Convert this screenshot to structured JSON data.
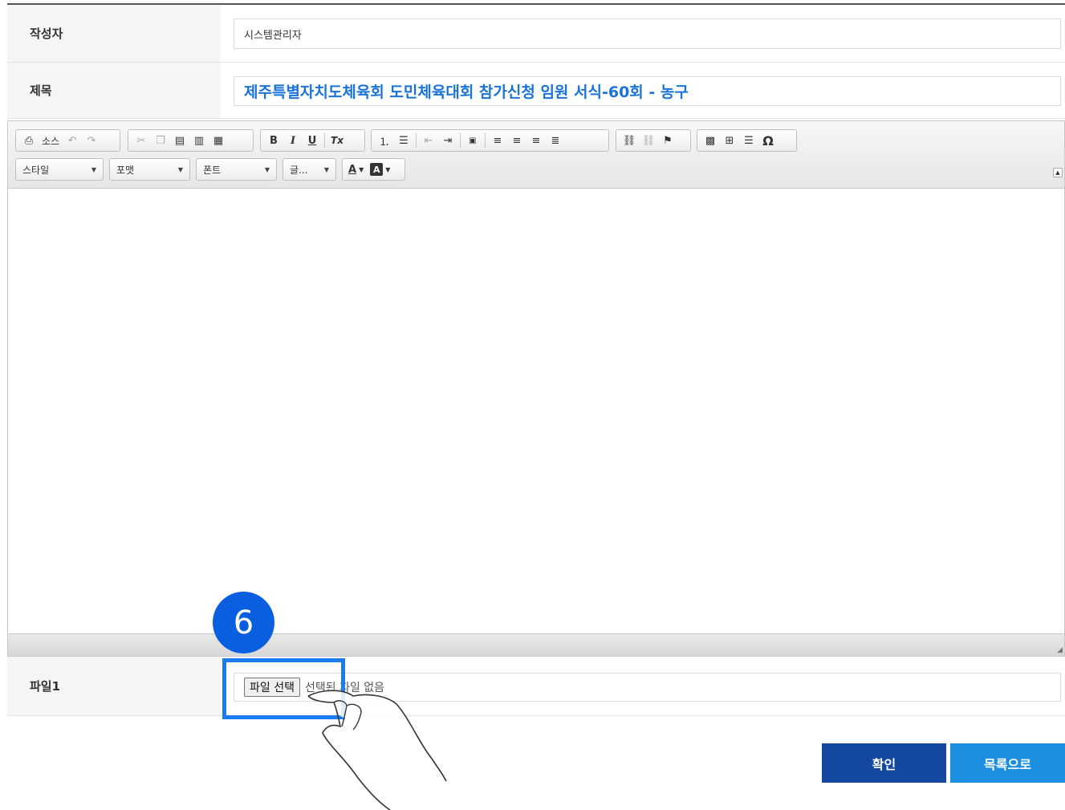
{
  "form": {
    "author": {
      "label": "작성자",
      "value": "시스템관리자"
    },
    "title": {
      "label": "제목",
      "value": "제주특별자치도체육회 도민체육대회 참가신청 임원 서식-60회 - 농구"
    },
    "file1": {
      "label": "파일1",
      "button": "파일 선택",
      "status": "선택된 파일 없음"
    }
  },
  "editor": {
    "source_label": "소스",
    "styles_label": "스타일",
    "format_label": "포맷",
    "font_label": "폰트",
    "size_label": "글...",
    "text_color_glyph": "A",
    "bg_color_glyph": "A",
    "bold": "B",
    "italic": "I",
    "underline": "U",
    "remove_format": "Tx",
    "special_char": "Ω"
  },
  "buttons": {
    "confirm": "확인",
    "list": "목록으로"
  },
  "annotation": {
    "step_number": "6"
  },
  "colors": {
    "title_text": "#1a73d8",
    "confirm_bg": "#1447a0",
    "list_bg": "#1c8fe0",
    "highlight": "#1a7cf0",
    "badge": "#0a5fe0"
  }
}
